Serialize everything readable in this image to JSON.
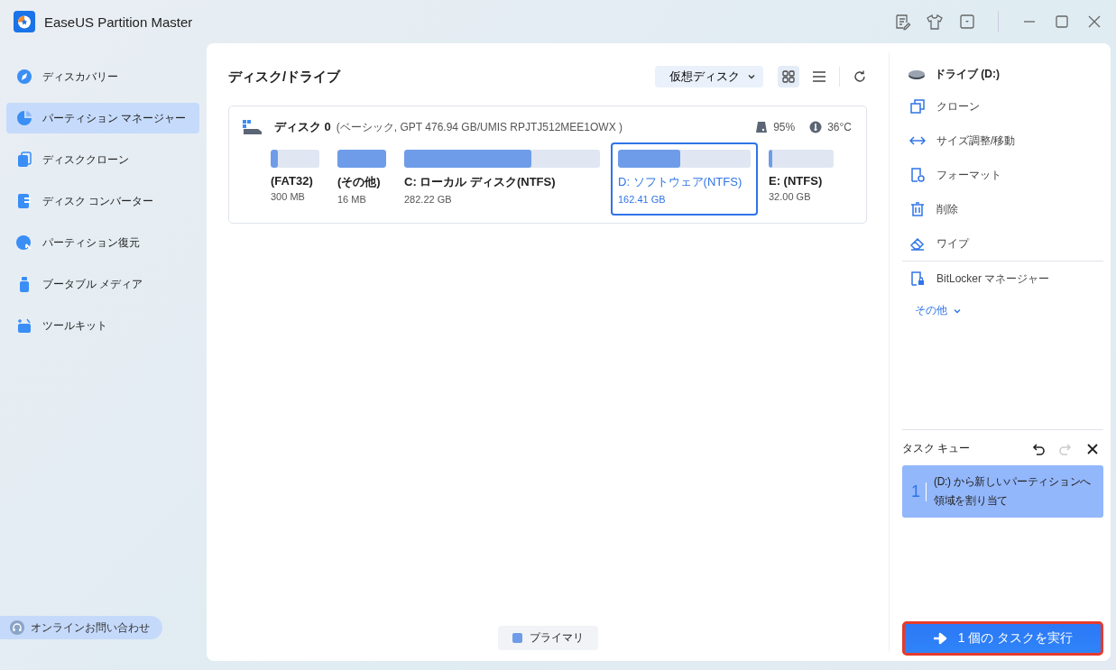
{
  "app": {
    "title": "EaseUS Partition Master"
  },
  "sidebar": {
    "items": [
      {
        "label": "ディスカバリー",
        "selected": false
      },
      {
        "label": "パーティション マネージャー",
        "selected": true
      },
      {
        "label": "ディスククローン",
        "selected": false
      },
      {
        "label": "ディスク コンバーター",
        "selected": false
      },
      {
        "label": "パーティション復元",
        "selected": false
      },
      {
        "label": "ブータブル メディア",
        "selected": false
      },
      {
        "label": "ツールキット",
        "selected": false
      }
    ],
    "support": "オンラインお問い合わせ"
  },
  "main": {
    "title": "ディスク/ドライブ",
    "virtual_disk": "仮想ディスク",
    "view_modes": [
      {
        "selected": true
      },
      {
        "selected": false
      }
    ],
    "disk": {
      "name": "ディスク 0",
      "details": "(ベーシック, GPT 476.94 GB/UMIS RPJTJ512MEE1OWX )",
      "health": "95%",
      "temperature": "36°C",
      "partitions": [
        {
          "label": "(FAT32)",
          "size": "300 MB",
          "level": 0.15,
          "selected": false
        },
        {
          "label": "(その他)",
          "size": "16 MB",
          "level": 1,
          "selected": false
        },
        {
          "label": "C: ローカル ディスク(NTFS)",
          "size": "282.22 GB",
          "level": 0.65,
          "selected": false
        },
        {
          "label": "D: ソフトウェア(NTFS)",
          "size": "162.41 GB",
          "level": 0.47,
          "selected": true
        },
        {
          "label": "E: (NTFS)",
          "size": "32.00 GB",
          "level": 0.05,
          "selected": false
        }
      ]
    },
    "legend": [
      {
        "label": "プライマリ",
        "color": "#6f9ce8"
      }
    ]
  },
  "right_panel": {
    "drive": "ドライブ (D:)",
    "actions": [
      "クローン",
      "サイズ調整/移動",
      "フォーマット",
      "削除",
      "ワイプ"
    ],
    "bitlocker": "BitLocker マネージャー",
    "more": "その他",
    "task_queue": {
      "title": "タスク キュー",
      "tasks": [
        {
          "number": "1",
          "text": "(D:) から新しいパーティションへ領域を割り当て"
        }
      ],
      "execute": "1 個の タスクを実行"
    }
  }
}
